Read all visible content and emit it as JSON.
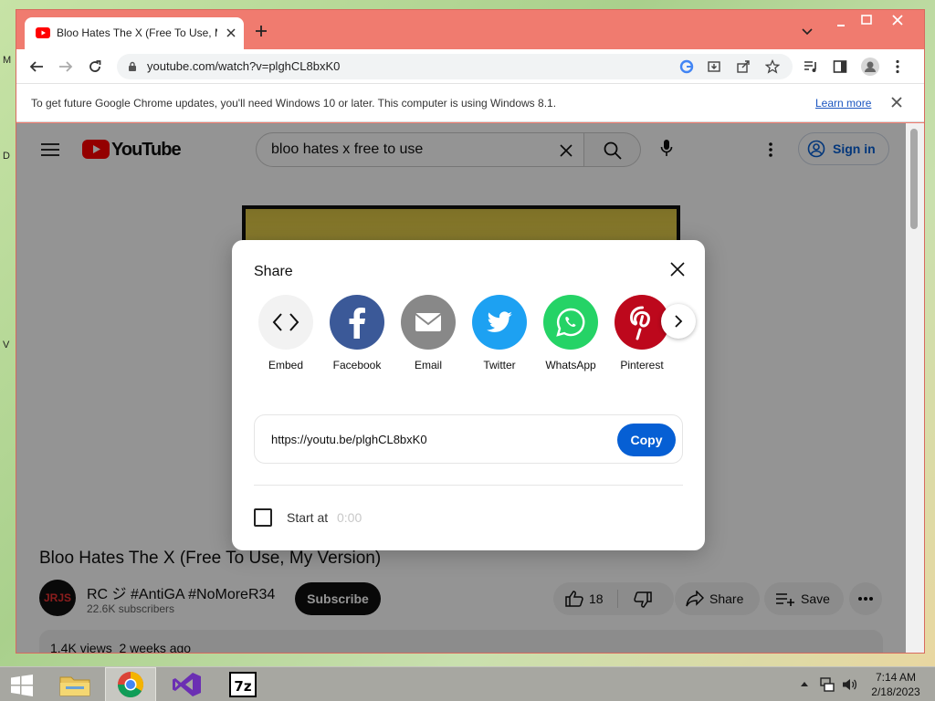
{
  "browser": {
    "tab_title": "Bloo Hates The X (Free To Use, My Version)",
    "url": "youtube.com/watch?v=plghCL8bxK0",
    "infobar_text": "To get future Google Chrome updates, you'll need Windows 10 or later. This computer is using Windows 8.1.",
    "infobar_link": "Learn more"
  },
  "youtube": {
    "logo_text": "YouTube",
    "search_query": "bloo hates x free to use",
    "sign_in": "Sign in",
    "video_title": "Bloo Hates The X (Free To Use, My Version)",
    "channel_avatar": "JRJS",
    "channel_name": "RC ジ #AntiGA #NoMoreR34",
    "subscribers": "22.6K subscribers",
    "subscribe": "Subscribe",
    "like_count": "18",
    "share": "Share",
    "save": "Save",
    "views_line": "1.4K views  2 weeks ago"
  },
  "share_dialog": {
    "title": "Share",
    "targets": [
      {
        "label": "Embed",
        "icon": "embed-icon",
        "color": "#f2f2f2"
      },
      {
        "label": "Facebook",
        "icon": "facebook-icon",
        "color": "#3b5998"
      },
      {
        "label": "Email",
        "icon": "email-icon",
        "color": "#888888"
      },
      {
        "label": "Twitter",
        "icon": "twitter-icon",
        "color": "#1da1f2"
      },
      {
        "label": "WhatsApp",
        "icon": "whatsapp-icon",
        "color": "#25d366"
      },
      {
        "label": "Pinterest",
        "icon": "pinterest-icon",
        "color": "#bd081c"
      }
    ],
    "link": "https://youtu.be/plghCL8bxK0",
    "copy": "Copy",
    "start_at_label": "Start at",
    "start_at_time": "0:00"
  },
  "taskbar": {
    "time": "7:14 AM",
    "date": "2/18/2023"
  }
}
